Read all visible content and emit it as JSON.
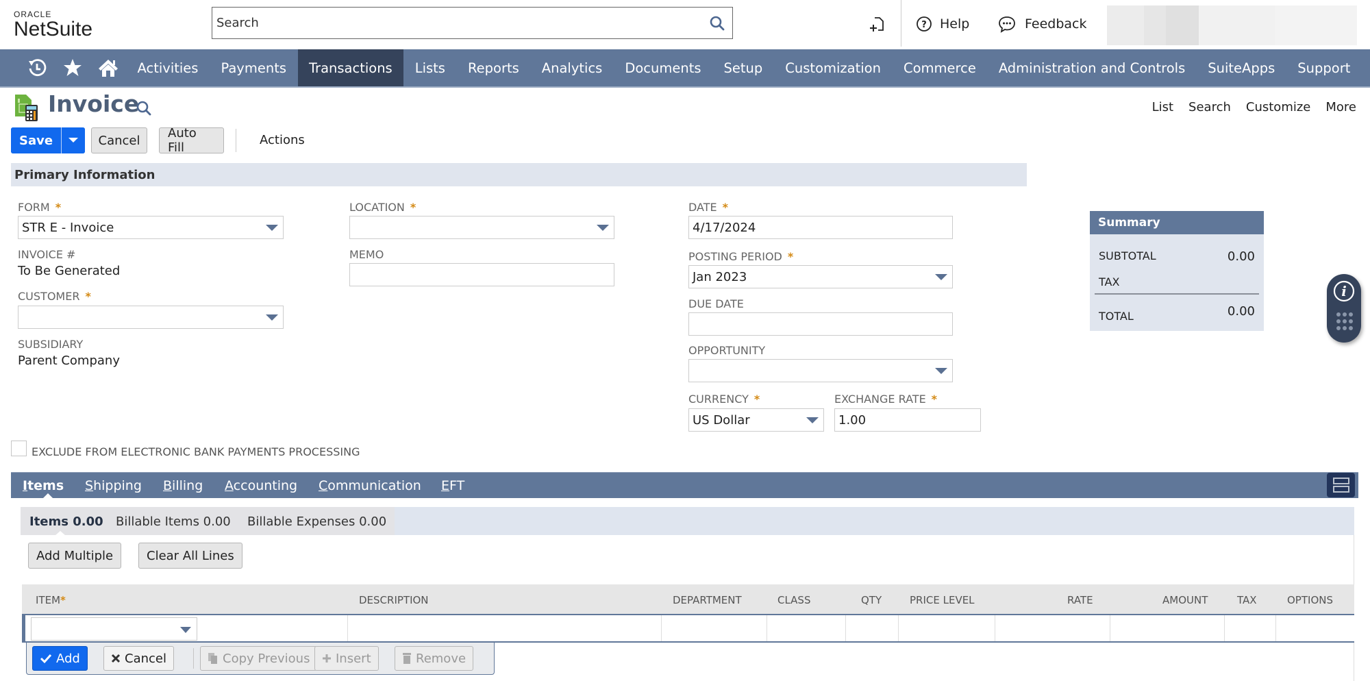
{
  "header": {
    "logo_top": "ORACLE",
    "logo_main": "NetSuite",
    "search_placeholder": "Search",
    "help_label": "Help",
    "feedback_label": "Feedback"
  },
  "nav": {
    "items": [
      {
        "label": "Activities"
      },
      {
        "label": "Payments"
      },
      {
        "label": "Transactions",
        "active": true
      },
      {
        "label": "Lists"
      },
      {
        "label": "Reports"
      },
      {
        "label": "Analytics"
      },
      {
        "label": "Documents"
      },
      {
        "label": "Setup"
      },
      {
        "label": "Customization"
      },
      {
        "label": "Commerce"
      },
      {
        "label": "Administration and Controls"
      },
      {
        "label": "SuiteApps"
      },
      {
        "label": "Support"
      }
    ]
  },
  "page": {
    "title": "Invoice",
    "top_links": [
      "List",
      "Search",
      "Customize",
      "More"
    ]
  },
  "toolbar": {
    "save": "Save",
    "cancel": "Cancel",
    "auto_fill": "Auto Fill",
    "actions": "Actions"
  },
  "primary": {
    "section_title": "Primary Information",
    "form": {
      "label": "FORM",
      "value": "STR E - Invoice"
    },
    "invoice_no": {
      "label": "INVOICE #",
      "value": "To Be Generated"
    },
    "customer": {
      "label": "CUSTOMER",
      "value": ""
    },
    "subsidiary": {
      "label": "SUBSIDIARY",
      "value": "Parent Company"
    },
    "location": {
      "label": "LOCATION",
      "value": ""
    },
    "memo": {
      "label": "MEMO",
      "value": ""
    },
    "date": {
      "label": "DATE",
      "value": "4/17/2024"
    },
    "posting_period": {
      "label": "POSTING PERIOD",
      "value": "Jan 2023"
    },
    "due_date": {
      "label": "DUE DATE",
      "value": ""
    },
    "opportunity": {
      "label": "OPPORTUNITY",
      "value": ""
    },
    "currency": {
      "label": "CURRENCY",
      "value": "US Dollar"
    },
    "exchange_rate": {
      "label": "EXCHANGE RATE",
      "value": "1.00"
    },
    "required_mark": "*"
  },
  "summary": {
    "title": "Summary",
    "subtotal_label": "SUBTOTAL",
    "subtotal_value": "0.00",
    "tax_label": "TAX",
    "tax_value": "",
    "total_label": "TOTAL",
    "total_value": "0.00"
  },
  "exclude_ebp": {
    "label": "EXCLUDE FROM ELECTRONIC BANK PAYMENTS PROCESSING",
    "checked": false
  },
  "tabs": [
    {
      "key": "I",
      "rest": "tems",
      "active": true
    },
    {
      "key": "S",
      "rest": "hipping"
    },
    {
      "key": "B",
      "rest": "illing"
    },
    {
      "key": "A",
      "rest": "ccounting"
    },
    {
      "key": "C",
      "rest": "ommunication"
    },
    {
      "key": "E",
      "rest": "FT"
    }
  ],
  "subtabs": {
    "items": "Items 0.00",
    "billable_items": "Billable Items 0.00",
    "billable_expenses": "Billable Expenses 0.00"
  },
  "sublist_buttons": {
    "add_multiple": "Add Multiple",
    "clear_all": "Clear All Lines"
  },
  "grid": {
    "columns": [
      "ITEM",
      "DESCRIPTION",
      "DEPARTMENT",
      "CLASS",
      "QTY",
      "PRICE LEVEL",
      "RATE",
      "AMOUNT",
      "TAX",
      "OPTIONS"
    ],
    "row_actions": {
      "add": "Add",
      "cancel": "Cancel",
      "copy_previous": "Copy Previous",
      "insert": "Insert",
      "remove": "Remove"
    }
  },
  "colors": {
    "nav_bg": "#607799",
    "nav_active": "#35435b",
    "primary_button": "#1169ee",
    "required": "#d48a15",
    "section_bg": "#e0e5ee"
  }
}
